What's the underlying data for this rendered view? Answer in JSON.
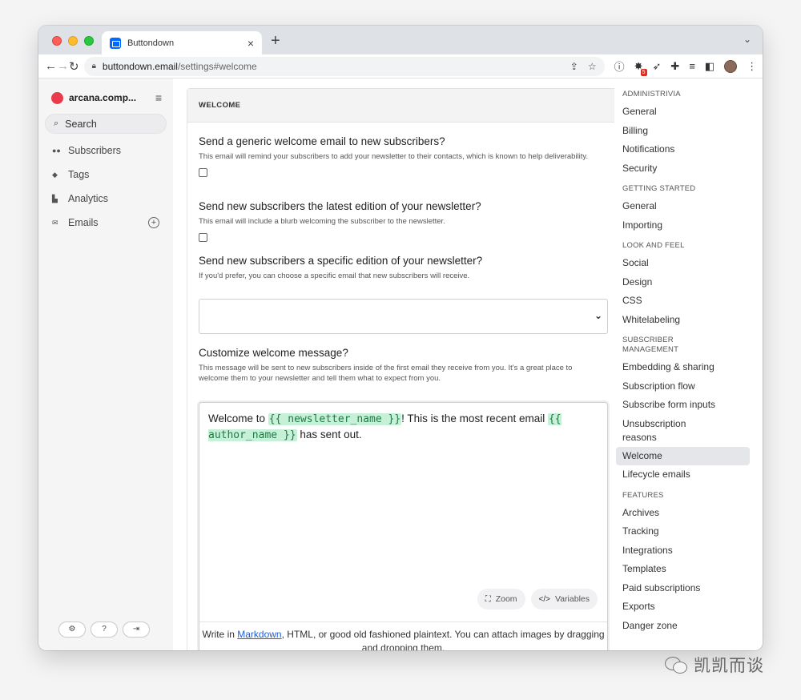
{
  "browser": {
    "tab_title": "Buttondown",
    "tab_close": "×",
    "new_tab": "+",
    "tab_menu": "⌄",
    "url_host": "buttondown.email",
    "url_path": "/settings#welcome"
  },
  "sidebar": {
    "account_name": "arcana.comp...",
    "search_label": "Search",
    "items": [
      {
        "label": "Subscribers",
        "icon": "users-icon"
      },
      {
        "label": "Tags",
        "icon": "tag-icon"
      },
      {
        "label": "Analytics",
        "icon": "chart-icon"
      },
      {
        "label": "Emails",
        "icon": "envelope-icon"
      }
    ],
    "emails_add": "+"
  },
  "main": {
    "section_title": "WELCOME",
    "q1_title": "Send a generic welcome email to new subscribers?",
    "q1_help": "This email will remind your subscribers to add your newsletter to their contacts, which is known to help deliverability.",
    "q2_title": "Send new subscribers the latest edition of your newsletter?",
    "q2_help": "This email will include a blurb welcoming the subscriber to the newsletter.",
    "q3_title": "Send new subscribers a specific edition of your newsletter?",
    "q3_help": "If you'd prefer, you can choose a specific email that new subscribers will receive.",
    "q4_title": "Customize welcome message?",
    "q4_help": "This message will be sent to new subscribers inside of the first email they receive from you. It's a great place to welcome them to your newsletter and tell them what to expect from you.",
    "editor": {
      "text_1": "Welcome to ",
      "tag_1": "{{ newsletter_name }}",
      "text_2": "! This is the most recent email ",
      "tag_2": "{{ author_name }}",
      "text_3": " has sent out.",
      "zoom_label": "Zoom",
      "variables_label": "Variables",
      "footer_pre": "Write in ",
      "footer_link": "Markdown",
      "footer_post": ", HTML, or good old fashioned plaintext. You can attach images by dragging and dropping them."
    }
  },
  "rightnav": {
    "administrivia_label": "ADMINISTRIVIA",
    "administrivia": [
      "General",
      "Billing",
      "Notifications",
      "Security"
    ],
    "getting_started_label": "GETTING STARTED",
    "getting_started": [
      "General",
      "Importing"
    ],
    "look_label": "LOOK AND FEEL",
    "look": [
      "Social",
      "Design",
      "CSS",
      "Whitelabeling"
    ],
    "subscriber_label_1": "SUBSCRIBER",
    "subscriber_label_2": "MANAGEMENT",
    "subscriber": [
      "Embedding & sharing",
      "Subscription flow",
      "Subscribe form inputs"
    ],
    "unsub_1": "Unsubscription",
    "unsub_2": "reasons",
    "welcome": "Welcome",
    "lifecycle": "Lifecycle emails",
    "features_label": "FEATURES",
    "features": [
      "Archives",
      "Tracking",
      "Integrations",
      "Templates",
      "Paid subscriptions",
      "Exports",
      "Danger zone"
    ]
  },
  "extension_badge": "5",
  "watermark": "凯凯而谈",
  "colors": {
    "brand_dot": "#eb3a49",
    "tag_bg": "#c6f1d8",
    "link": "#1f5fd6",
    "active_nav_bg": "#e5e6ea"
  }
}
